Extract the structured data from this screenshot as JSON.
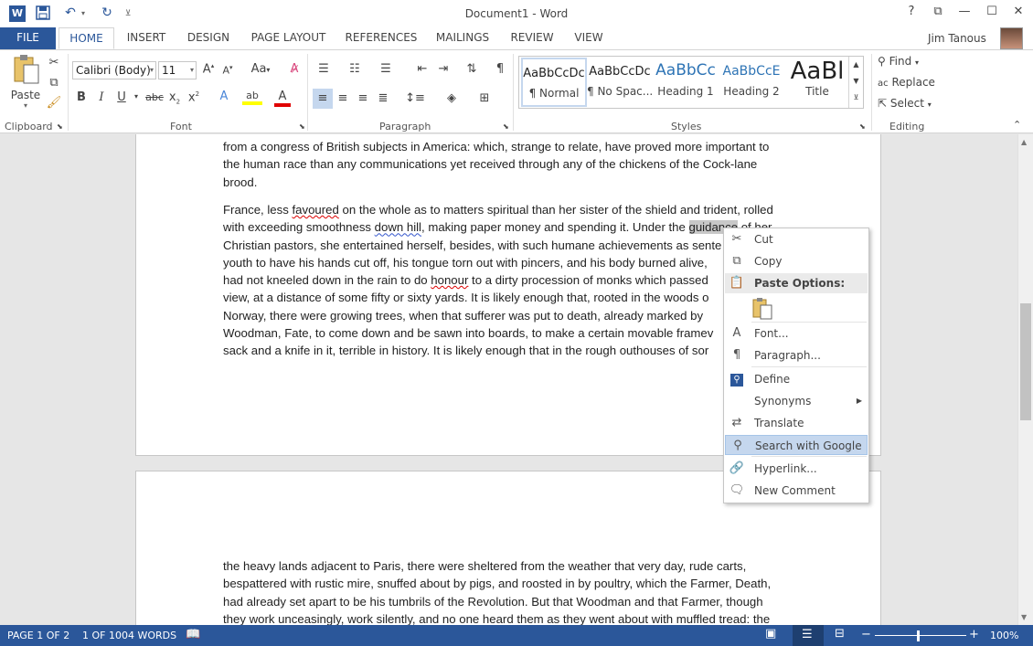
{
  "quick_access": {
    "word_icon": "W",
    "save_icon": "save-icon",
    "undo_icon": "undo-icon",
    "redo_icon": "redo-icon"
  },
  "window": {
    "title": "Document1 - Word",
    "help": "?",
    "restore_ribbon": "⧉",
    "minimize": "—",
    "maximize": "☐",
    "close": "✕"
  },
  "tabs": [
    "FILE",
    "HOME",
    "INSERT",
    "DESIGN",
    "PAGE LAYOUT",
    "REFERENCES",
    "MAILINGS",
    "REVIEW",
    "VIEW"
  ],
  "user": {
    "name": "Jim Tanous"
  },
  "ribbon": {
    "clipboard": {
      "label": "Clipboard",
      "paste": "Paste"
    },
    "font": {
      "label": "Font",
      "family": "Calibri (Body)",
      "size": "11"
    },
    "paragraph": {
      "label": "Paragraph"
    },
    "styles": {
      "label": "Styles",
      "items": [
        {
          "sample": "AaBbCcDc",
          "name": "¶ Normal"
        },
        {
          "sample": "AaBbCcDc",
          "name": "¶ No Spac..."
        },
        {
          "sample": "AaBbCc",
          "name": "Heading 1"
        },
        {
          "sample": "AaBbCcE",
          "name": "Heading 2"
        },
        {
          "sample": "AaBl",
          "name": "Title"
        }
      ]
    },
    "editing": {
      "label": "Editing",
      "find": "Find",
      "replace": "Replace",
      "select": "Select"
    }
  },
  "document": {
    "page1_lines_a": [
      "from a congress of British subjects in America: which, strange to relate, have proved more important to",
      "the human race than any communications yet received through any of the chickens of the Cock-lane",
      "brood."
    ],
    "page1_lines_b": [
      "Christian pastors, she entertained herself, besides, with such humane achievements as sente",
      "youth to have his hands cut off, his tongue torn out with pincers, and his body burned alive,",
      "view, at a distance of some fifty or sixty yards. It is likely enough that, rooted in the woods o",
      "Norway, there were growing trees, when that sufferer was put to death, already marked by",
      "Woodman, Fate, to come down and be sawn into boards, to make a certain movable framev",
      "sack and a knife in it, terrible in history. It is likely enough that in the rough outhouses of sor"
    ],
    "line1": {
      "a": "France, less ",
      "b": "favoured",
      "c": " on the whole as to matters spiritual than her sister of the shield and trident, rolled"
    },
    "line2": {
      "a": "with exceeding smoothness ",
      "b": "down hill",
      "c": ", making paper money and spending it. Under the ",
      "d": "guidance",
      "e": " of her"
    },
    "line5": {
      "a": "had not kneeled down in the rain to do ",
      "b": "honour",
      "c": " to a dirty procession of monks which passed"
    },
    "page2_lines": [
      "the heavy lands adjacent to Paris, there were sheltered from the weather that very day, rude carts,",
      "bespattered with rustic mire, snuffed about by pigs, and roosted in by poultry, which the Farmer, Death,",
      "had already set apart to be his tumbrils of the Revolution. But that Woodman and that Farmer, though",
      "they work unceasingly, work silently, and no one heard them as they went about with muffled tread: the"
    ]
  },
  "context_menu": {
    "cut": "Cut",
    "copy": "Copy",
    "paste_options": "Paste Options:",
    "font": "Font...",
    "paragraph": "Paragraph...",
    "define": "Define",
    "synonyms": "Synonyms",
    "translate": "Translate",
    "search_google": "Search with Google",
    "hyperlink": "Hyperlink...",
    "new_comment": "New Comment"
  },
  "status": {
    "page": "PAGE 1 OF 2",
    "words": "1 OF 1004 WORDS",
    "zoom": "100%"
  },
  "colors": {
    "accent": "#2b579a",
    "highlight_yellow": "#ffff00",
    "font_red": "#e00000"
  }
}
